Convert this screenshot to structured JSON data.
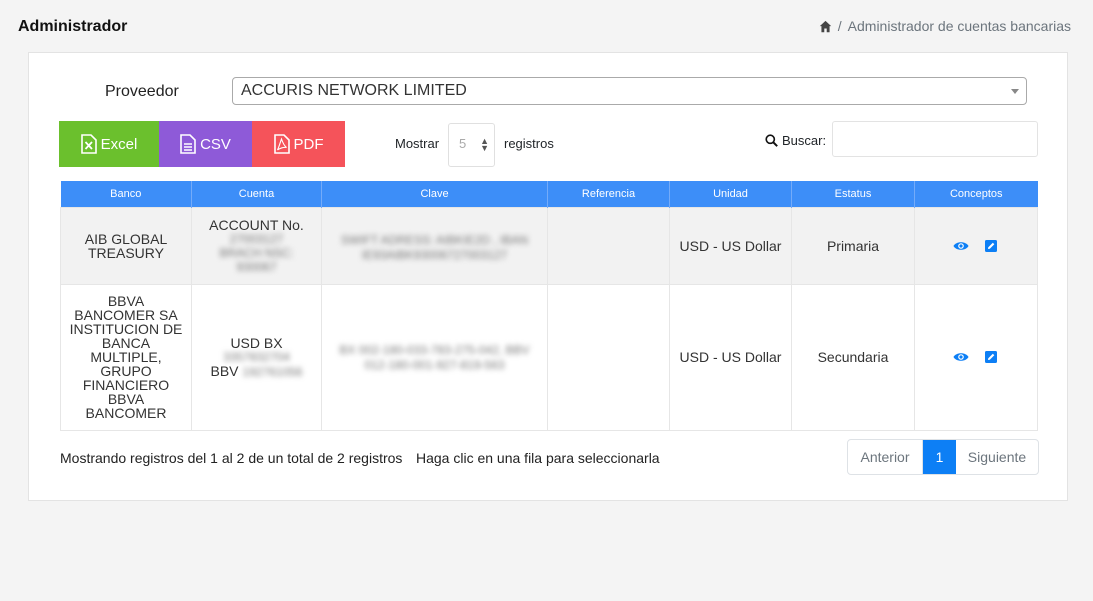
{
  "header": {
    "title": "Administrador",
    "breadcrumb_separator": "/",
    "breadcrumb_current": "Administrador de cuentas bancarias"
  },
  "filter": {
    "provider_label": "Proveedor",
    "provider_value": "ACCURIS NETWORK LIMITED"
  },
  "export_buttons": {
    "excel": "Excel",
    "csv": "CSV",
    "pdf": "PDF"
  },
  "length": {
    "prefix": "Mostrar",
    "value": "5",
    "suffix": "registros"
  },
  "search": {
    "label": "Buscar:",
    "value": ""
  },
  "table": {
    "columns": [
      "Banco",
      "Cuenta",
      "Clave",
      "Referencia",
      "Unidad",
      "Estatus",
      "Conceptos"
    ],
    "rows": [
      {
        "banco": "AIB GLOBAL TREASURY",
        "cuenta_line1": "ACCOUNT No.",
        "cuenta_line2": "27003127",
        "cuenta_line3": "BRACH NSC:",
        "cuenta_line4": "930067",
        "clave": "SWIFT ADRESS: AIBKIE2D , IBAN IE93AIBK93006727003127",
        "referencia": "",
        "unidad": "USD - US Dollar",
        "estatus": "Primaria"
      },
      {
        "banco": "BBVA BANCOMER SA INSTITUCION DE BANCA MULTIPLE, GRUPO FINANCIERO BBVA BANCOMER",
        "cuenta_line1": "USD BX",
        "cuenta_line2": "3357832704",
        "cuenta_line3": "BBV",
        "cuenta_line4": "192761056",
        "clave": "BX 002-180-033-783-275-042, BBV 012-180-001-927-819-563",
        "referencia": "",
        "unidad": "USD - US Dollar",
        "estatus": "Secundaria"
      }
    ]
  },
  "footer": {
    "info": "Mostrando registros del 1 al 2 de un total de 2 registros",
    "hint": "Haga clic en una fila para seleccionarla",
    "prev": "Anterior",
    "page": "1",
    "next": "Siguiente"
  },
  "colors": {
    "header_blue": "#3d8ef8",
    "excel_green": "#6bc02d",
    "csv_purple": "#8e5ad8",
    "pdf_red": "#f5535a",
    "page_active": "#0d7ff5"
  }
}
